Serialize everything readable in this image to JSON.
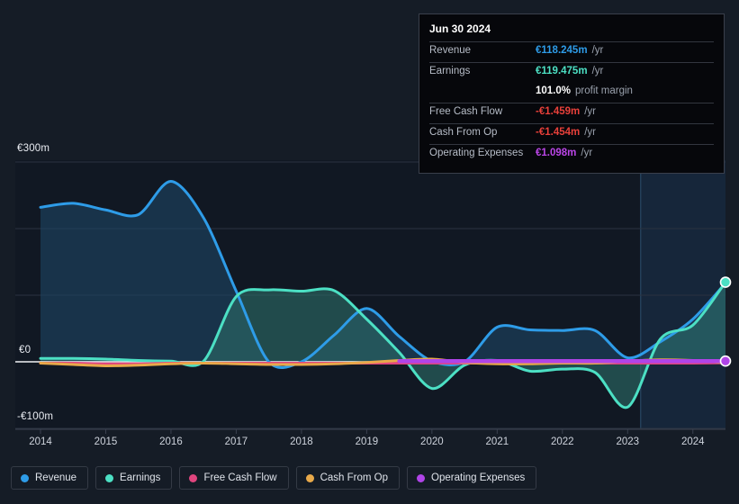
{
  "tooltip": {
    "date": "Jun 30 2024",
    "rows": [
      {
        "name": "Revenue",
        "value": "€118.245m",
        "unit": "/yr",
        "color": "#2e9ce8"
      },
      {
        "name": "Earnings",
        "value": "€119.475m",
        "unit": "/yr",
        "color": "#4ce0c4"
      },
      {
        "name": "",
        "value": "101.0%",
        "unit": "profit margin",
        "color": "#ffffff"
      },
      {
        "name": "Free Cash Flow",
        "value": "-€1.459m",
        "unit": "/yr",
        "color": "#e8403a"
      },
      {
        "name": "Cash From Op",
        "value": "-€1.454m",
        "unit": "/yr",
        "color": "#e8403a"
      },
      {
        "name": "Operating Expenses",
        "value": "€1.098m",
        "unit": "/yr",
        "color": "#bb46e8"
      }
    ]
  },
  "legend": {
    "items": [
      {
        "label": "Revenue",
        "color": "#2e9ce8"
      },
      {
        "label": "Earnings",
        "color": "#4ce0c4"
      },
      {
        "label": "Free Cash Flow",
        "color": "#e0457e"
      },
      {
        "label": "Cash From Op",
        "color": "#e8a94a"
      },
      {
        "label": "Operating Expenses",
        "color": "#b044e8"
      }
    ]
  },
  "axes": {
    "y_labels": [
      {
        "text": "€300m",
        "value": 300
      },
      {
        "text": "€0",
        "value": 0
      },
      {
        "text": "-€100m",
        "value": -100
      }
    ],
    "x_labels": [
      "2014",
      "2015",
      "2016",
      "2017",
      "2018",
      "2019",
      "2020",
      "2021",
      "2022",
      "2023",
      "2024"
    ]
  },
  "chart_data": {
    "type": "area",
    "title": "",
    "xlabel": "",
    "ylabel": "",
    "ylim": [
      -100,
      300
    ],
    "xlim": [
      2014,
      2024.5
    ],
    "grid": true,
    "gridlines": [
      300,
      200,
      100,
      0,
      -100
    ],
    "zero_line": 0,
    "legend_position": "bottom",
    "currency": "EUR",
    "units": "millions",
    "highlight_band": {
      "from": 2023.2,
      "to": 2024.5
    },
    "x": [
      2014,
      2014.5,
      2015,
      2015.5,
      2016,
      2016.5,
      2017,
      2017.5,
      2018,
      2018.5,
      2019,
      2019.5,
      2020,
      2020.5,
      2021,
      2021.5,
      2022,
      2022.5,
      2023,
      2023.5,
      2024,
      2024.5
    ],
    "series": [
      {
        "name": "Revenue",
        "color": "#2e9ce8",
        "fill": "#1d4463",
        "values": [
          232,
          238,
          228,
          221,
          271,
          216,
          106,
          0,
          0,
          40,
          80,
          38,
          1,
          0,
          52,
          48,
          47,
          47,
          6,
          30,
          64,
          118.245
        ]
      },
      {
        "name": "Earnings",
        "color": "#4ce0c4",
        "fill": "#2c6b66",
        "values": [
          5,
          5,
          4,
          2,
          1,
          1,
          98,
          108,
          106,
          107,
          64,
          14,
          -40,
          -5,
          2,
          -14,
          -11,
          -16,
          -68,
          34,
          55,
          119.475
        ]
      },
      {
        "name": "Free Cash Flow",
        "color": "#e0457e",
        "fill": "#5a2436",
        "values": [
          -2,
          -2,
          -3,
          -3,
          -2,
          -2,
          -2,
          -2,
          -2,
          -2,
          -2,
          -2,
          -2,
          -2,
          -2,
          -2,
          -2,
          -2,
          -2,
          -2,
          -2,
          -1.459
        ]
      },
      {
        "name": "Cash From Op",
        "color": "#e8a94a",
        "fill": "#6b4f24",
        "values": [
          -2,
          -4,
          -6,
          -5,
          -3,
          -2,
          -3,
          -4,
          -4,
          -3,
          -1,
          2,
          4,
          -1,
          -3,
          -3,
          -2,
          -2,
          1,
          3,
          2,
          -1.454
        ]
      },
      {
        "name": "Operating Expenses",
        "color": "#b044e8",
        "fill": "#4b2363",
        "values": [
          null,
          null,
          null,
          null,
          null,
          null,
          null,
          null,
          null,
          null,
          null,
          1.1,
          1.1,
          1.1,
          1.1,
          1.1,
          1.1,
          1.1,
          1.1,
          1.1,
          1.1,
          1.098
        ]
      }
    ],
    "end_markers": [
      {
        "series": "Earnings",
        "x": 2024.5,
        "y": 119.475,
        "color": "#4ce0c4"
      },
      {
        "series": "Operating Expenses",
        "x": 2024.5,
        "y": 1.098,
        "color": "#b044e8"
      }
    ]
  }
}
